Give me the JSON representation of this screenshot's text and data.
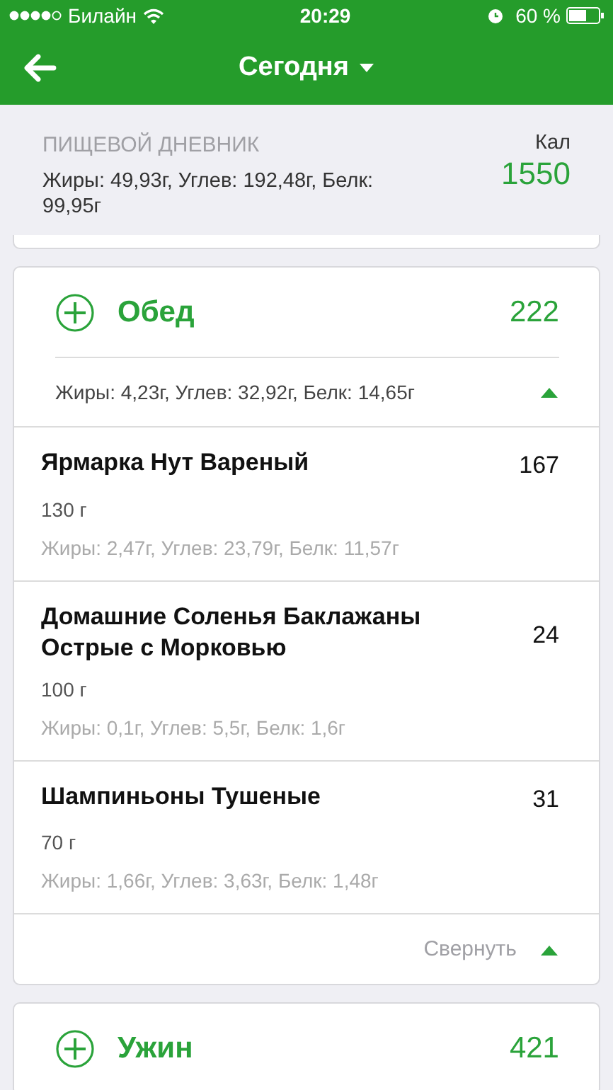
{
  "status_bar": {
    "carrier": "Билайн",
    "time": "20:29",
    "battery": "60 %"
  },
  "navbar": {
    "title": "Сегодня"
  },
  "summary": {
    "heading": "ПИЩЕВОЙ ДНЕВНИК",
    "macros": "Жиры: 49,93г, Углев: 192,48г, Белк: 99,95г",
    "calories_label": "Кал",
    "calories": "1550"
  },
  "meals": [
    {
      "name": "Обед",
      "calories": "222",
      "macros": "Жиры: 4,23г, Углев: 32,92г, Белк: 14,65г",
      "expanded": true,
      "collapse_label": "Свернуть",
      "items": [
        {
          "name": "Ярмарка Нут Вареный",
          "calories": "167",
          "amount": "130 г",
          "macros": "Жиры: 2,47г, Углев: 23,79г, Белк: 11,57г"
        },
        {
          "name": "Домашние Соленья Баклажаны Острые с Морковью",
          "calories": "24",
          "amount": "100 г",
          "macros": "Жиры: 0,1г, Углев: 5,5г, Белк: 1,6г"
        },
        {
          "name": "Шампиньоны Тушеные",
          "calories": "31",
          "amount": "70 г",
          "macros": "Жиры: 1,66г, Углев: 3,63г, Белк: 1,48г"
        }
      ]
    },
    {
      "name": "Ужин",
      "calories": "421"
    }
  ]
}
